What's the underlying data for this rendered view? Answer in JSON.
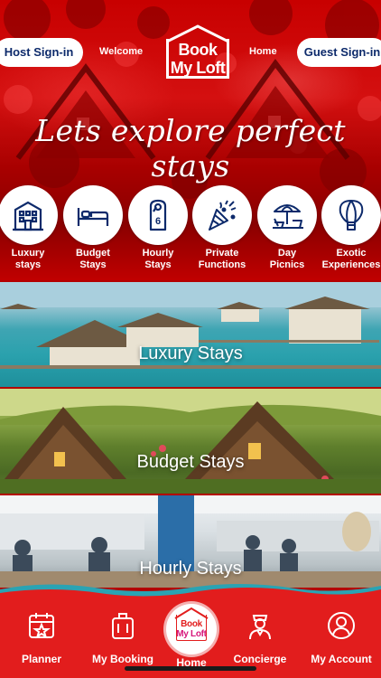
{
  "header": {
    "host_signin": "Host Sign-in",
    "welcome": "Welcome",
    "logo_line1": "Book",
    "logo_line2": "My Loft",
    "home": "Home",
    "guest_signin": "Guest Sign-in"
  },
  "hero": {
    "tagline": "Lets explore perfect stays"
  },
  "categories": [
    {
      "label1": "Luxury",
      "label2": "stays",
      "icon": "hotel-building-icon"
    },
    {
      "label1": "Budget",
      "label2": "Stays",
      "icon": "bed-icon"
    },
    {
      "label1": "Hourly",
      "label2": "Stays",
      "icon": "door-hanger-icon"
    },
    {
      "label1": "Private",
      "label2": "Functions",
      "icon": "party-popper-icon"
    },
    {
      "label1": "Day",
      "label2": "Picnics",
      "icon": "beach-umbrella-icon"
    },
    {
      "label1": "Exotic",
      "label2": "Experiences",
      "icon": "hot-air-balloon-icon"
    }
  ],
  "sections": [
    {
      "title": "Luxury Stays"
    },
    {
      "title": "Budget Stays"
    },
    {
      "title": "Hourly Stays"
    }
  ],
  "bottom_nav": {
    "planner": "Planner",
    "my_booking": "My Booking",
    "home": "Home",
    "home_logo_line1": "Book",
    "home_logo_line2": "My Loft",
    "concierge": "Concierge",
    "my_account": "My Account"
  },
  "colors": {
    "brand_red": "#e21d1d",
    "navy_text": "#0d2a6b",
    "hero_red": "#c80000"
  }
}
